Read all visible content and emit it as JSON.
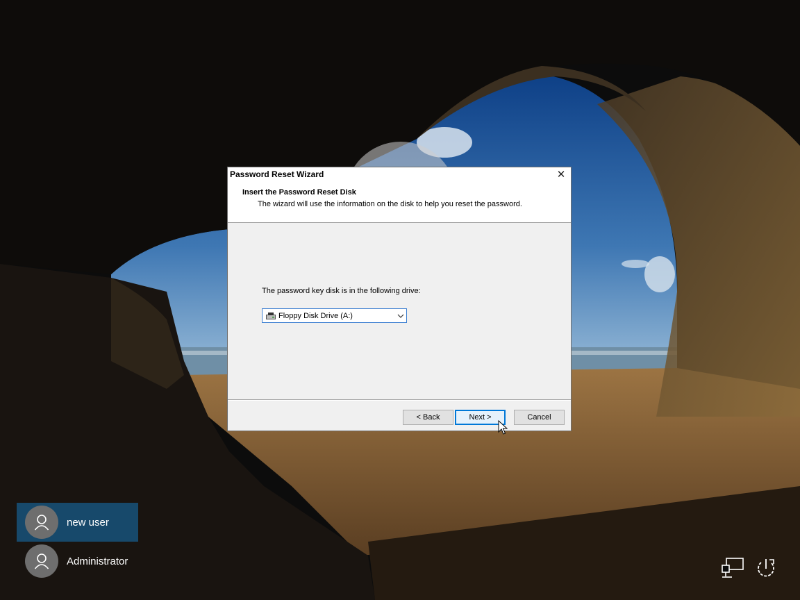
{
  "dialog": {
    "title": "Password Reset Wizard",
    "close_glyph": "✕",
    "heading": "Insert the Password Reset Disk",
    "subheading": "The wizard will use the information on the disk to help you reset the password.",
    "drive_label": "The password key disk is in the following drive:",
    "drive_selected": "Floppy Disk Drive (A:)",
    "drive_icon": "floppy-drive-icon",
    "back_label": "< Back",
    "next_label": "Next >",
    "cancel_label": "Cancel"
  },
  "users": [
    {
      "name": "new user",
      "selected": true,
      "icon": "person-icon"
    },
    {
      "name": "Administrator",
      "selected": false,
      "icon": "person-icon"
    }
  ],
  "system_icons": [
    "network-icon",
    "power-icon"
  ],
  "colors": {
    "selected_tile": "#17496b",
    "focus_button_border": "#0078d7",
    "dialog_bg": "#f0f0f0"
  }
}
